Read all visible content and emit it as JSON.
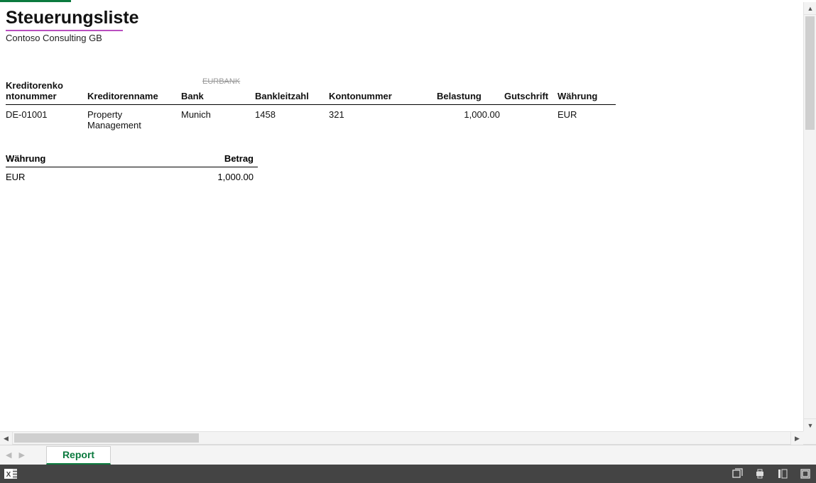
{
  "report": {
    "title": "Steuerungsliste",
    "subtitle": "Contoso Consulting GB",
    "ghost_bank_text": "EURBANK",
    "columns": {
      "kreditorenkontonummer": "Kreditorenko\nntonummer",
      "kreditorenname": "Kreditorenname",
      "bank": "Bank",
      "bankleitzahl": "Bankleitzahl",
      "kontonummer": "Kontonummer",
      "belastung": "Belastung",
      "gutschrift": "Gutschrift",
      "waehrung": "Währung"
    },
    "rows": [
      {
        "kreditorenkontonummer": "DE-01001",
        "kreditorenname": "Property Management",
        "bank": "Munich",
        "bankleitzahl": "1458",
        "kontonummer": "321",
        "belastung": "1,000.00",
        "gutschrift": "",
        "waehrung": "EUR"
      }
    ],
    "summary": {
      "columns": {
        "waehrung": "Währung",
        "betrag": "Betrag"
      },
      "rows": [
        {
          "waehrung": "EUR",
          "betrag": "1,000.00"
        }
      ]
    }
  },
  "tabs": {
    "report": "Report"
  }
}
